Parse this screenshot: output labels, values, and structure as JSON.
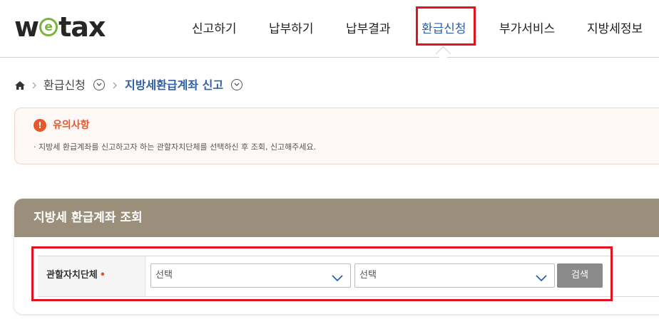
{
  "header": {
    "logo": {
      "prefix": "w",
      "mid": "e",
      "suffix": "tax"
    },
    "nav": [
      {
        "label": "신고하기"
      },
      {
        "label": "납부하기"
      },
      {
        "label": "납부결과"
      },
      {
        "label": "환급신청",
        "active": true
      },
      {
        "label": "부가서비스"
      },
      {
        "label": "지방세정보"
      }
    ]
  },
  "breadcrumb": {
    "level1": "환급신청",
    "level2": "지방세환급계좌 신고"
  },
  "notice": {
    "title": "유의사항",
    "icon_symbol": "!",
    "text": "· 지방세 환급계좌를 신고하고자 하는 관할자치단체를 선택하신 후 조회, 신고해주세요."
  },
  "panel": {
    "title": "지방세 환급계좌 조회",
    "field_label": "관할자치단체",
    "required_mark": "•",
    "select1": {
      "value": "선택"
    },
    "select2": {
      "value": "선택"
    },
    "search_button": "검색"
  },
  "colors": {
    "accent_blue": "#2e5fa8",
    "highlight_red": "#e0141e",
    "warning_orange": "#e8572a",
    "panel_header": "#9b8f7c",
    "logo_green": "#7ab33e"
  }
}
